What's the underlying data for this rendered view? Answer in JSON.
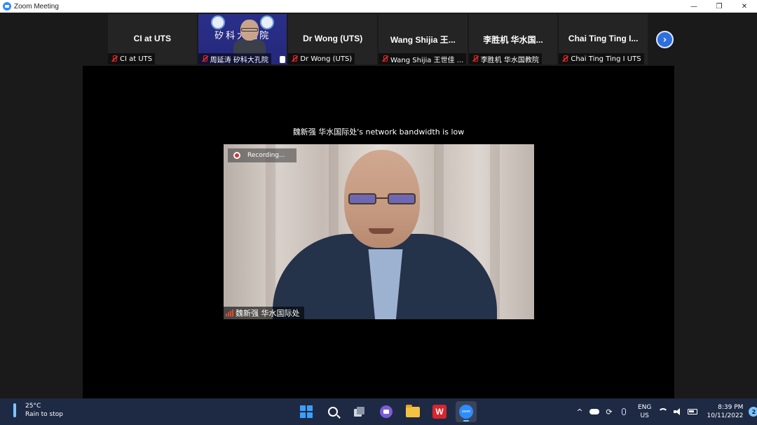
{
  "window": {
    "title": "Zoom Meeting",
    "controls": {
      "minimize": "—",
      "restore": "❐",
      "close": "✕"
    }
  },
  "thumbnails": [
    {
      "display_name": "CI at UTS",
      "label": "CI at UTS",
      "muted": true,
      "video": false
    },
    {
      "display_name": "",
      "label": "周延涛 矽科大孔院",
      "muted": true,
      "video": true,
      "banner_text": "矽科大孔院"
    },
    {
      "display_name": "Dr Wong (UTS)",
      "label": "Dr Wong (UTS)",
      "muted": true,
      "video": false
    },
    {
      "display_name": "Wang Shijia 王...",
      "label": "Wang Shijia 王世佳 ...",
      "muted": true,
      "video": false
    },
    {
      "display_name": "李胜机 华水国...",
      "label": "李胜机 华水国教院",
      "muted": true,
      "video": false
    },
    {
      "display_name": "Chai Ting Ting I...",
      "label": "Chai Ting Ting I UTS",
      "muted": true,
      "video": false
    }
  ],
  "next_page": "›",
  "speaker": {
    "bandwidth_notice": "魏新强 华水国际处's network bandwidth is low",
    "recording_label": "Recording...",
    "name": "魏新强 华水国际处"
  },
  "taskbar": {
    "weather_temp": "25°C",
    "weather_desc": "Rain to stop",
    "apps": [
      "start-icon",
      "search-icon",
      "task-view-icon",
      "teams-chat-icon",
      "file-explorer-icon",
      "wps-icon",
      "zoom-icon"
    ],
    "wps_letter": "W",
    "zoom_text": "zoom",
    "tray_chevron": "^",
    "lang_line1": "ENG",
    "lang_line2": "US",
    "time": "8:39 PM",
    "date": "10/11/2022",
    "notification_count": "2"
  },
  "colors": {
    "accent": "#2d8cff",
    "muted_red": "#e02828",
    "taskbar": "#1e2a44"
  }
}
